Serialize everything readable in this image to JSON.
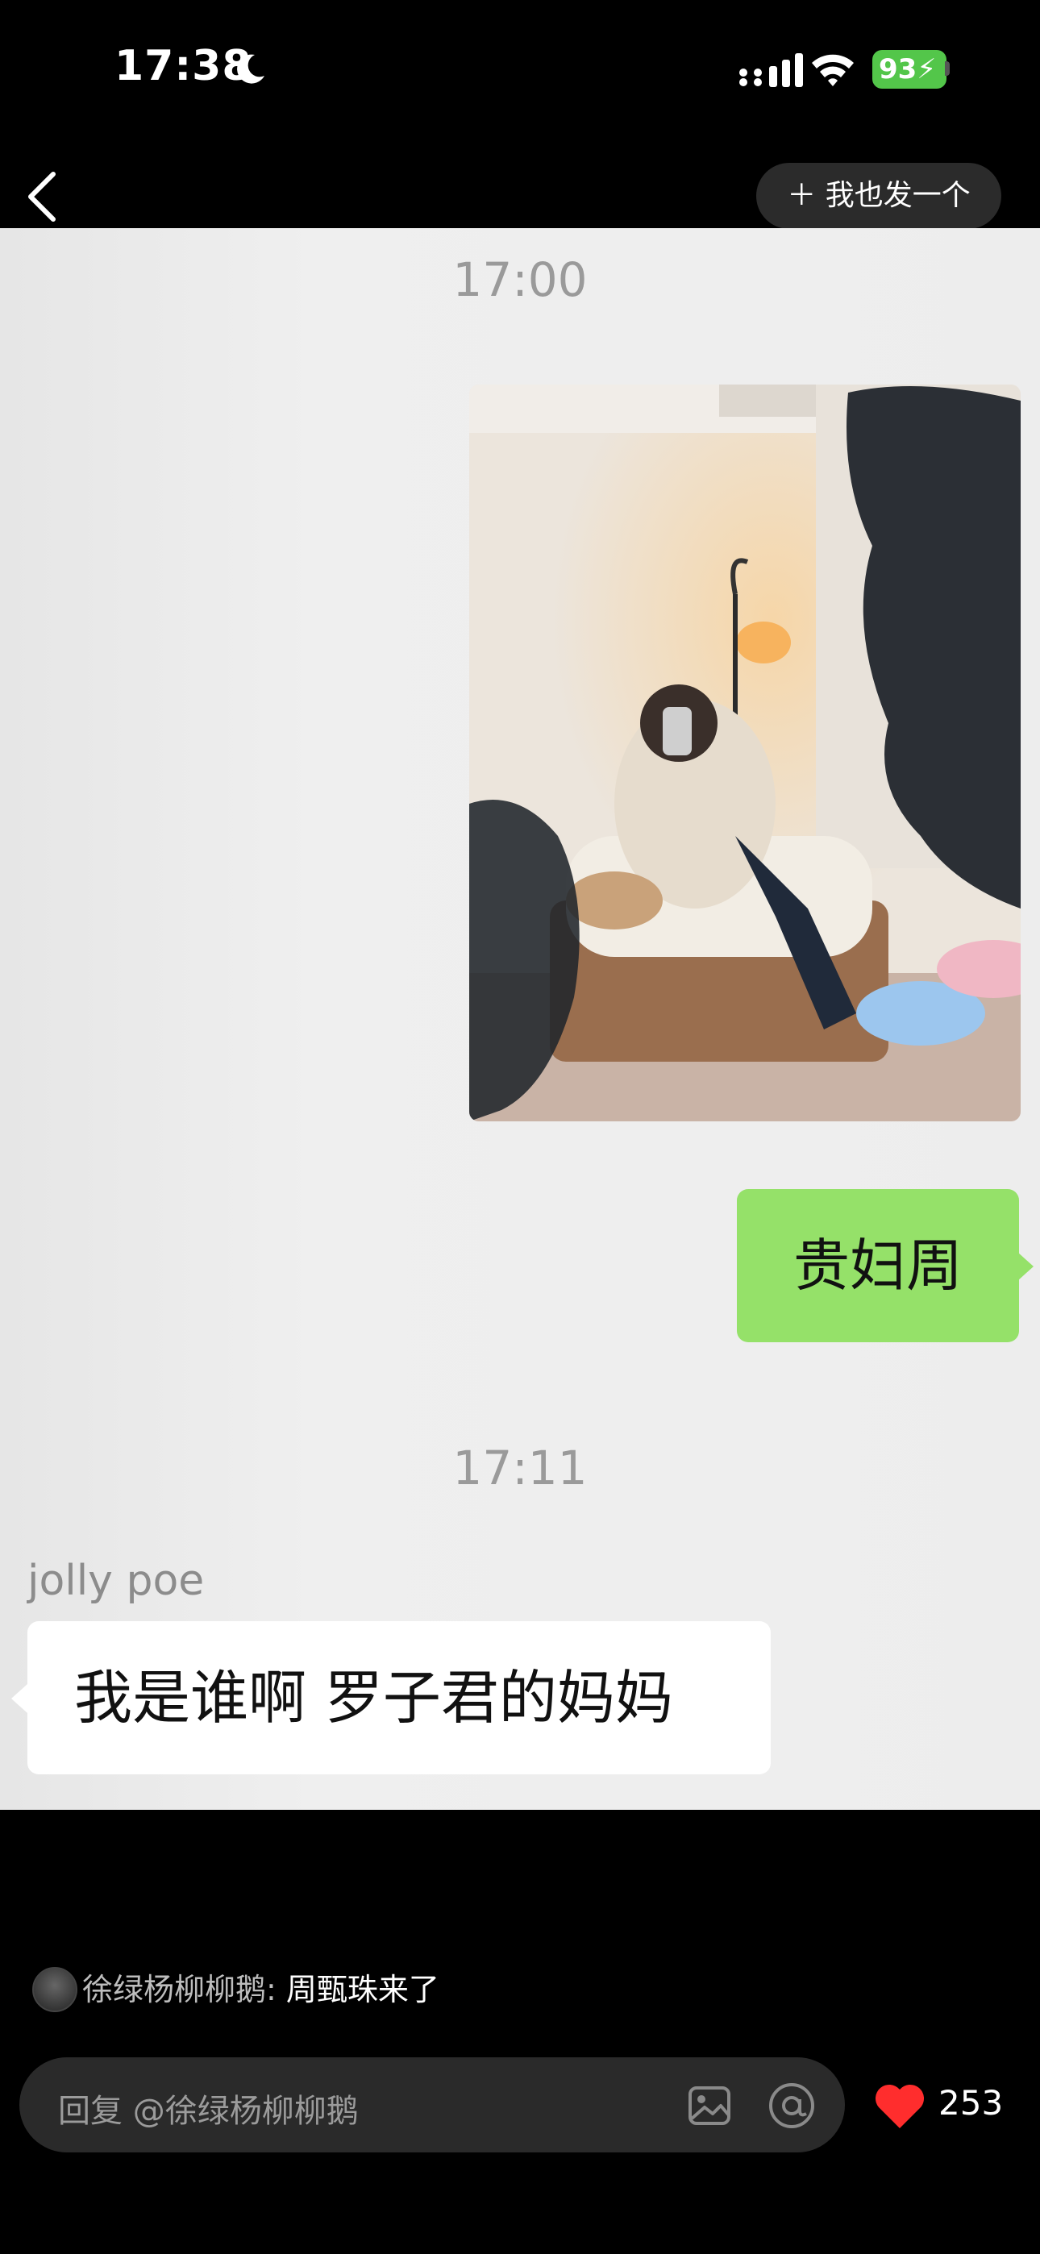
{
  "status_bar": {
    "time": "17:38",
    "battery": "93"
  },
  "nav": {
    "post_button_label": "我也发一个"
  },
  "chat": {
    "timestamp_1": "17:00",
    "sent_text": "贵妇周",
    "timestamp_2": "17:11",
    "sender_name": "jolly poe",
    "received_text": "我是谁啊 罗子君的妈妈"
  },
  "comment": {
    "name": "徐绿杨柳柳鹅",
    "separator": ":",
    "text": "周甄珠来了"
  },
  "reply": {
    "placeholder": "回复 @徐绿杨柳柳鹅"
  },
  "likes": {
    "count": "253"
  },
  "colors": {
    "bubble_green": "#95e169",
    "heart": "#ff2d2d",
    "battery": "#53c64a"
  }
}
